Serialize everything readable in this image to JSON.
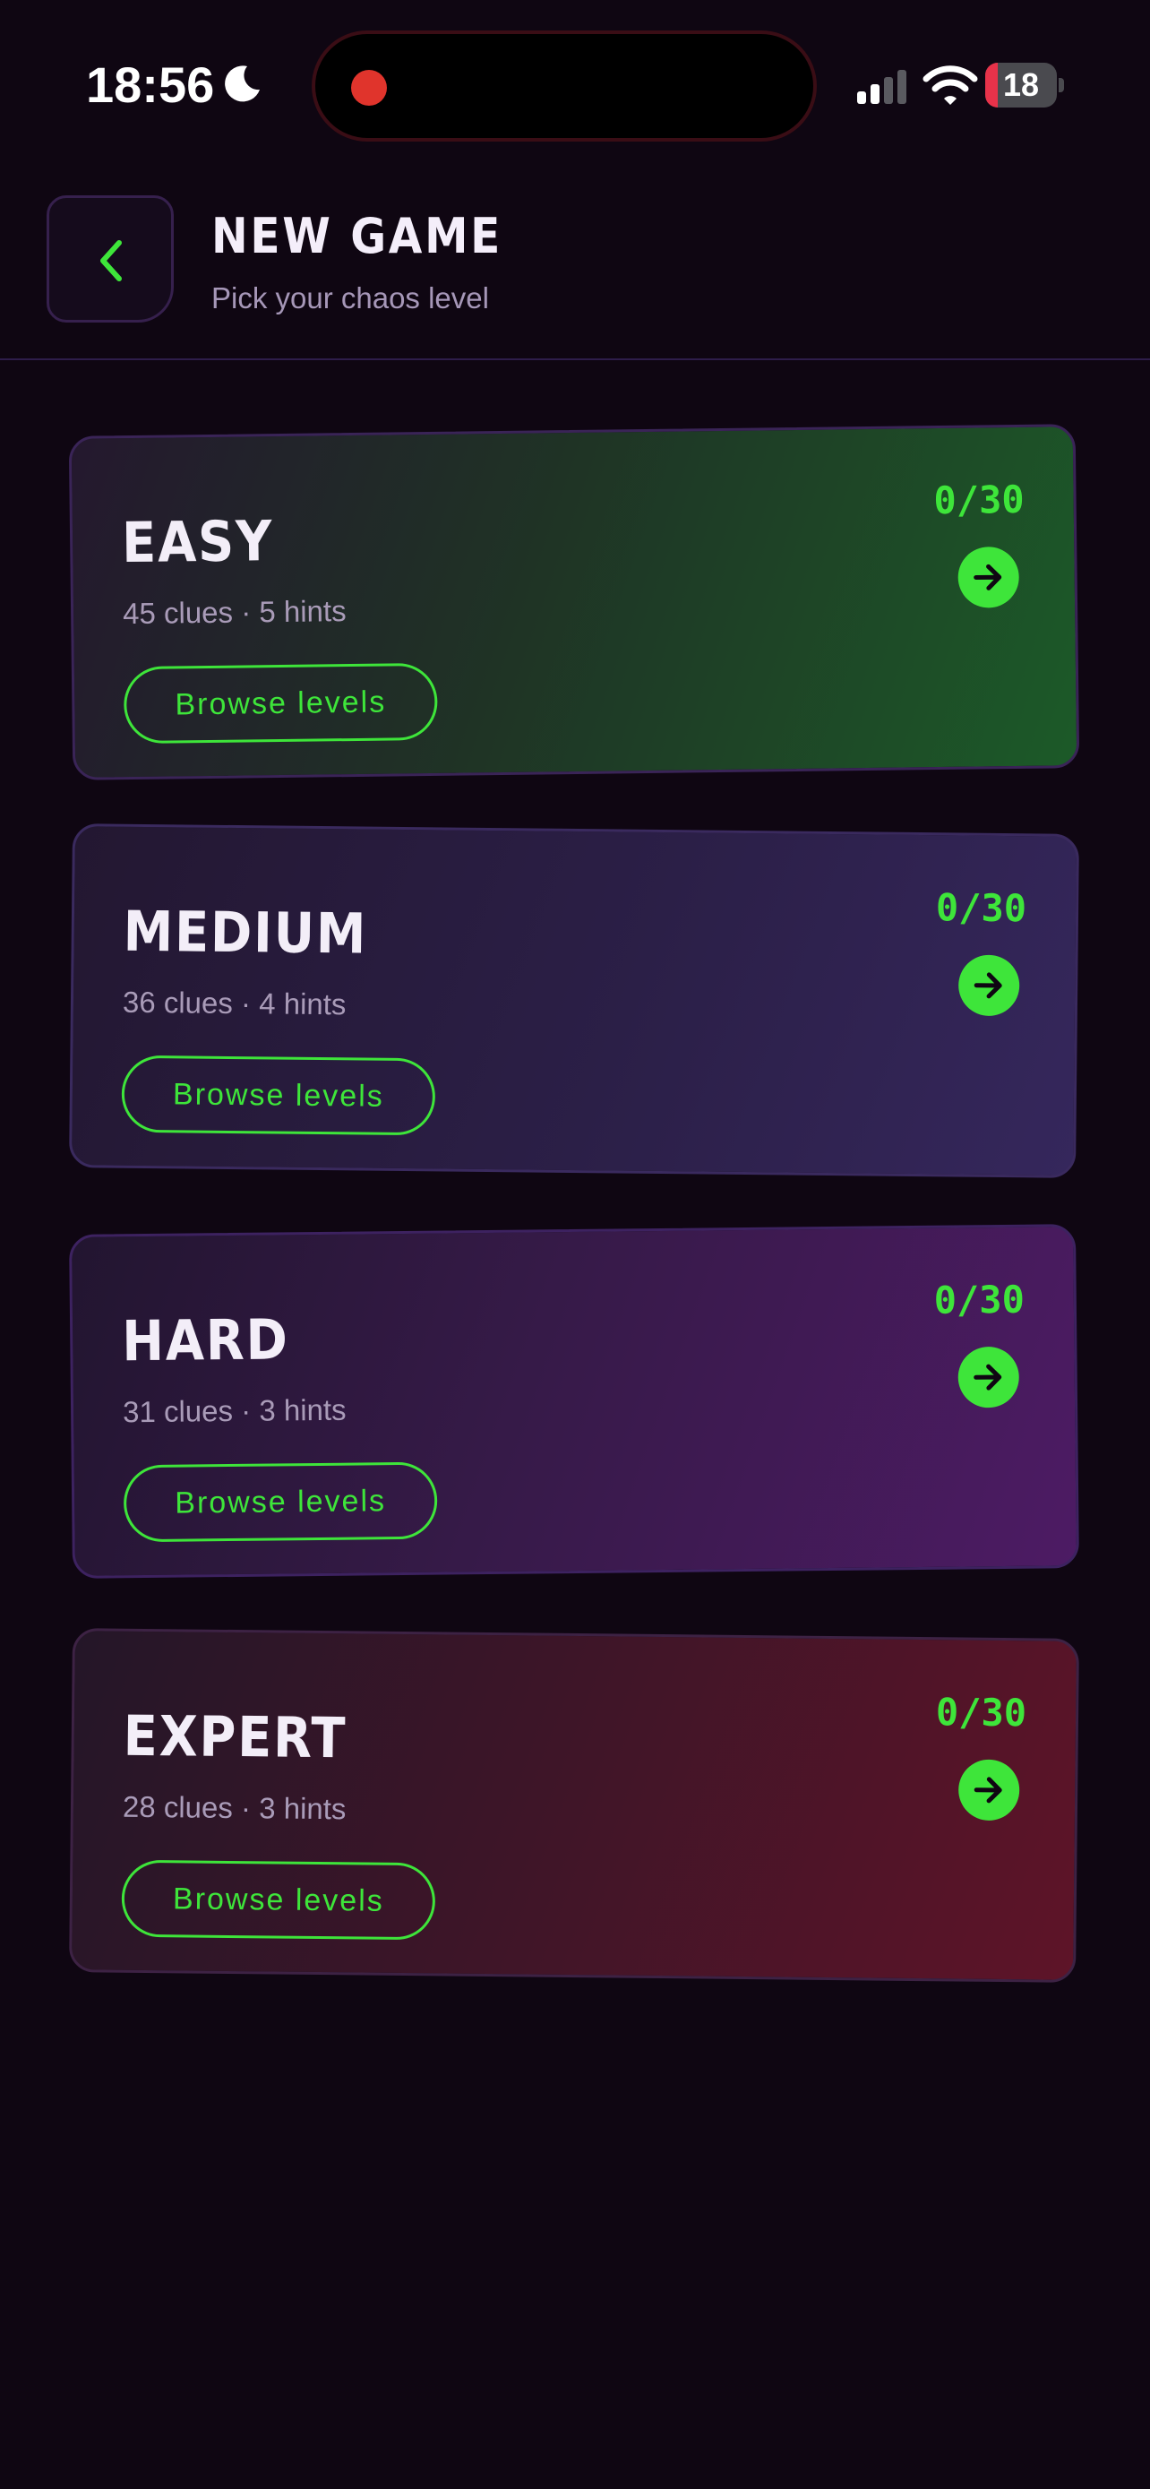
{
  "status_bar": {
    "time": "18:56",
    "battery_level": "18",
    "battery_fraction": 0.18
  },
  "header": {
    "title": "NEW GAME",
    "subtitle": "Pick your chaos level"
  },
  "levels": [
    {
      "title": "EASY",
      "meta": "45 clues · 5 hints",
      "browse_label": "Browse levels",
      "progress": "0/30"
    },
    {
      "title": "MEDIUM",
      "meta": "36 clues · 4 hints",
      "browse_label": "Browse levels",
      "progress": "0/30"
    },
    {
      "title": "HARD",
      "meta": "31 clues · 3 hints",
      "browse_label": "Browse levels",
      "progress": "0/30"
    },
    {
      "title": "EXPERT",
      "meta": "28 clues · 3 hints",
      "browse_label": "Browse levels",
      "progress": "0/30"
    }
  ],
  "colors": {
    "background": "#0f0612",
    "accent": "#3ee53a",
    "title_text": "#f3eef8",
    "muted_text": "#a99bb8",
    "easy_tint": "#1c5a28",
    "medium_tint": "#35275c",
    "hard_tint": "#4d1b64",
    "expert_tint": "#5e1428",
    "recording_dot": "#e0342c",
    "battery_low": "#e8324a"
  }
}
